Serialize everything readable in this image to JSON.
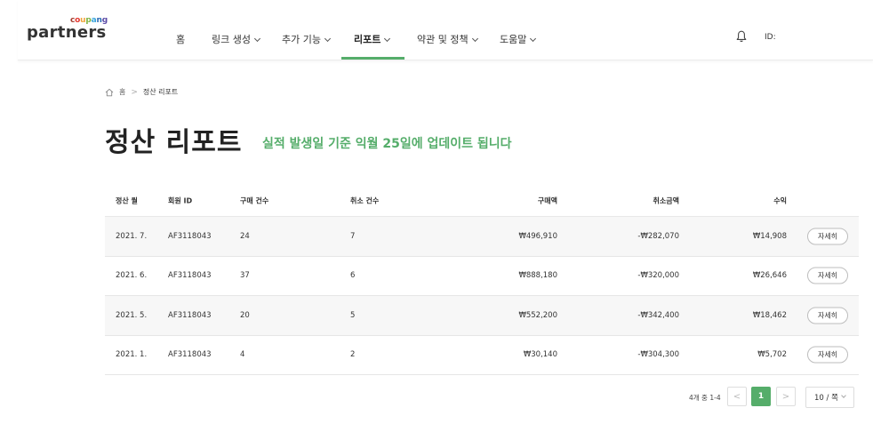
{
  "brand": {
    "coupang_letters": [
      "c",
      "o",
      "u",
      "p",
      "a",
      "n",
      "g"
    ],
    "partners": "partners",
    "accent_color": "#55ad6a"
  },
  "nav": {
    "items": [
      {
        "label": "홈",
        "has_dropdown": false
      },
      {
        "label": "링크 생성",
        "has_dropdown": true
      },
      {
        "label": "추가 기능",
        "has_dropdown": true
      },
      {
        "label": "리포트",
        "has_dropdown": true,
        "active": true
      },
      {
        "label": "약관 및 정책",
        "has_dropdown": true
      },
      {
        "label": "도움말",
        "has_dropdown": true
      }
    ],
    "bell_icon": "bell-icon",
    "user_id_label": "ID:"
  },
  "breadcrumb": {
    "home_icon": "home-icon",
    "home": "홈",
    "separator": ">",
    "current": "정산 리포트"
  },
  "page": {
    "title": "정산 리포트",
    "subtitle": "실적 발생일 기준 익월 25일에 업데이트 됩니다"
  },
  "table": {
    "headers": {
      "month": "정산 월",
      "member_id": "회원 ID",
      "purchase_count": "구매 건수",
      "cancel_count": "취소 건수",
      "purchase_amount": "구매액",
      "cancel_amount": "취소금액",
      "profit": "수익"
    },
    "rows": [
      {
        "month": "2021. 7.",
        "member_id": "AF3118043",
        "purchase_count": "24",
        "cancel_count": "7",
        "purchase_amount": "₩496,910",
        "cancel_amount": "-₩282,070",
        "profit": "₩14,908",
        "detail": "자세히"
      },
      {
        "month": "2021. 6.",
        "member_id": "AF3118043",
        "purchase_count": "37",
        "cancel_count": "6",
        "purchase_amount": "₩888,180",
        "cancel_amount": "-₩320,000",
        "profit": "₩26,646",
        "detail": "자세히"
      },
      {
        "month": "2021. 5.",
        "member_id": "AF3118043",
        "purchase_count": "20",
        "cancel_count": "5",
        "purchase_amount": "₩552,200",
        "cancel_amount": "-₩342,400",
        "profit": "₩18,462",
        "detail": "자세히"
      },
      {
        "month": "2021. 1.",
        "member_id": "AF3118043",
        "purchase_count": "4",
        "cancel_count": "2",
        "purchase_amount": "₩30,140",
        "cancel_amount": "-₩304,300",
        "profit": "₩5,702",
        "detail": "자세히"
      }
    ]
  },
  "pagination": {
    "summary": "4개 중 1-4",
    "prev": "<",
    "current_page": "1",
    "next": ">",
    "page_size": "10 / 쪽"
  }
}
